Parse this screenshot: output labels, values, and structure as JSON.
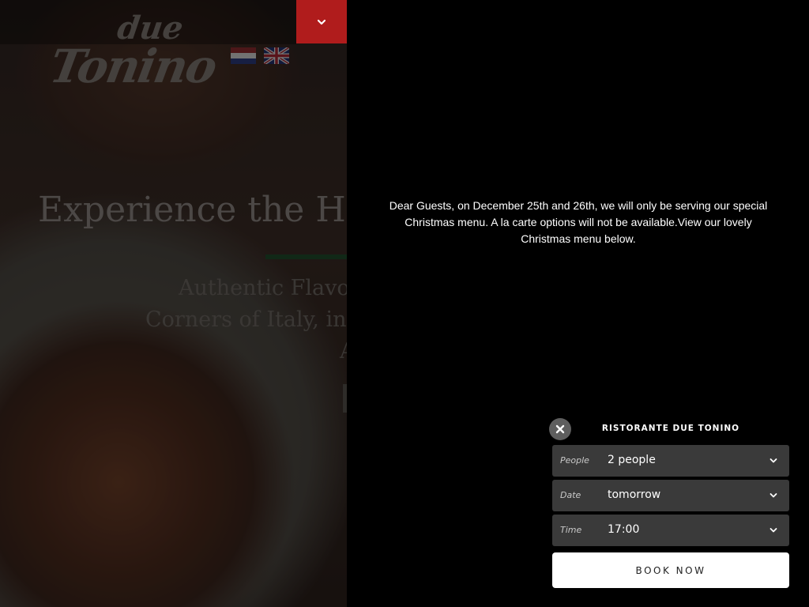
{
  "header": {
    "logo_text_top": "due",
    "logo_text_bottom": "Tonino",
    "menu_toggle_icon": "chevron-down-icon",
    "languages": [
      {
        "code": "nl",
        "icon": "flag-netherlands-icon"
      },
      {
        "code": "en",
        "icon": "flag-uk-icon"
      }
    ],
    "accent_color": "#b01c1c"
  },
  "hero": {
    "heading": "Experience the He",
    "subheading_lines": [
      "Authentic Flavo",
      "Corners of Italy, in",
      "A"
    ]
  },
  "notice": {
    "text": "Dear Guests, on December 25th and 26th, we will only be serving our special Christmas menu. A la carte options will not be available.View our lovely Christmas menu below."
  },
  "booking": {
    "title": "RISTORANTE DUE TONINO",
    "close_icon": "close-icon",
    "people": {
      "label": "People",
      "value": "2 people"
    },
    "date": {
      "label": "Date",
      "value": "tomorrow"
    },
    "time": {
      "label": "Time",
      "value": "17:00"
    },
    "submit_label": "BOOK NOW"
  }
}
